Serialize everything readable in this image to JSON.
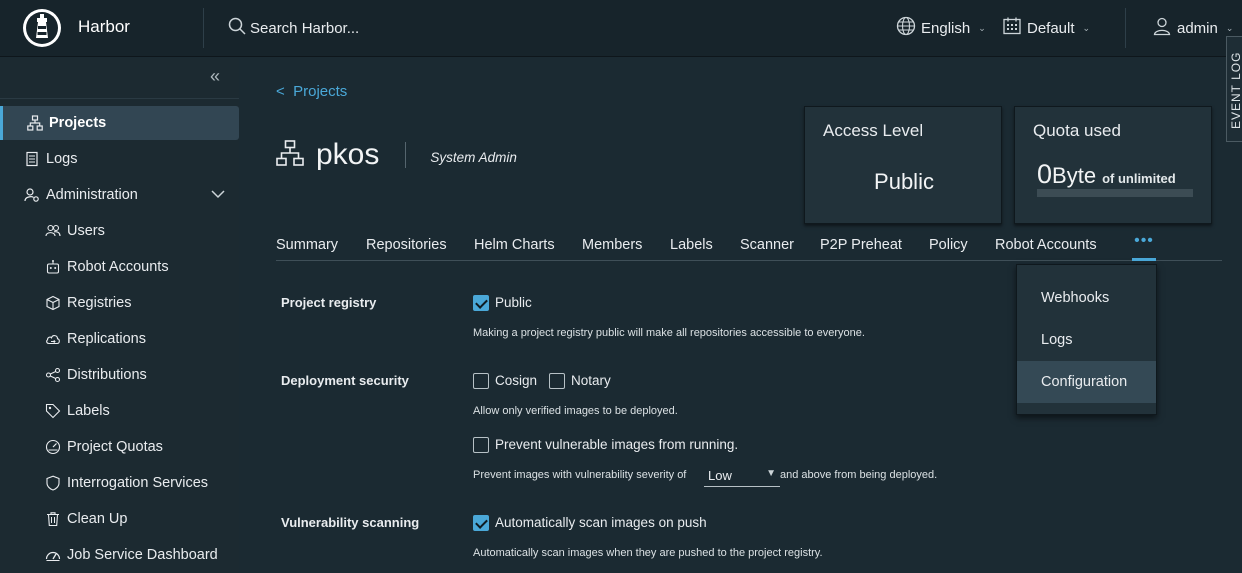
{
  "header": {
    "brand": "Harbor",
    "search_text": "Search Harbor...",
    "language": "English",
    "datetime_format": "Default",
    "user": "admin",
    "event_log": "EVENT LOG"
  },
  "sidebar": {
    "items": [
      {
        "label": "Projects",
        "icon": "projects-icon"
      },
      {
        "label": "Logs",
        "icon": "logs-icon"
      },
      {
        "label": "Administration",
        "icon": "administration-icon"
      },
      {
        "label": "Users",
        "icon": "users-icon"
      },
      {
        "label": "Robot Accounts",
        "icon": "robot-icon"
      },
      {
        "label": "Registries",
        "icon": "registries-icon"
      },
      {
        "label": "Replications",
        "icon": "replications-icon"
      },
      {
        "label": "Distributions",
        "icon": "distributions-icon"
      },
      {
        "label": "Labels",
        "icon": "labels-icon"
      },
      {
        "label": "Project Quotas",
        "icon": "quotas-icon"
      },
      {
        "label": "Interrogation Services",
        "icon": "shield-icon"
      },
      {
        "label": "Clean Up",
        "icon": "trash-icon"
      },
      {
        "label": "Job Service Dashboard",
        "icon": "dashboard-icon"
      }
    ]
  },
  "main": {
    "breadcrumb": "Projects",
    "breadcrumb_arrow": "<",
    "project_name": "pkos",
    "role": "System Admin",
    "access_card": {
      "title": "Access Level",
      "value": "Public"
    },
    "quota_card": {
      "title": "Quota used",
      "number": "0",
      "unit": "Byte",
      "suffix": "of unlimited",
      "fill_fraction": 0
    },
    "tabs": [
      "Summary",
      "Repositories",
      "Helm Charts",
      "Members",
      "Labels",
      "Scanner",
      "P2P Preheat",
      "Policy",
      "Robot Accounts"
    ],
    "more_tab": "•••",
    "dropdown": [
      "Webhooks",
      "Logs",
      "Configuration"
    ],
    "config": {
      "project_registry": {
        "label": "Project registry",
        "checkbox": "Public",
        "checked": true,
        "help": "Making a project registry public will make all repositories accessible to everyone."
      },
      "deployment_security": {
        "label": "Deployment security",
        "cosign": "Cosign",
        "notary": "Notary",
        "help": "Allow only verified images to be deployed.",
        "prevent": "Prevent vulnerable images from running.",
        "severity_prefix": "Prevent images with vulnerability severity of",
        "severity_value": "Low",
        "severity_suffix": "and above from being deployed."
      },
      "vulnerability_scanning": {
        "label": "Vulnerability scanning",
        "checkbox": "Automatically scan images on push",
        "checked": true,
        "help": "Automatically scan images when they are pushed to the project registry."
      }
    }
  },
  "colors": {
    "accent": "#4aa8d8",
    "header_bg": "#17242b",
    "sidebar_bg": "#1c2a31",
    "body_bg": "#1b2a32"
  }
}
